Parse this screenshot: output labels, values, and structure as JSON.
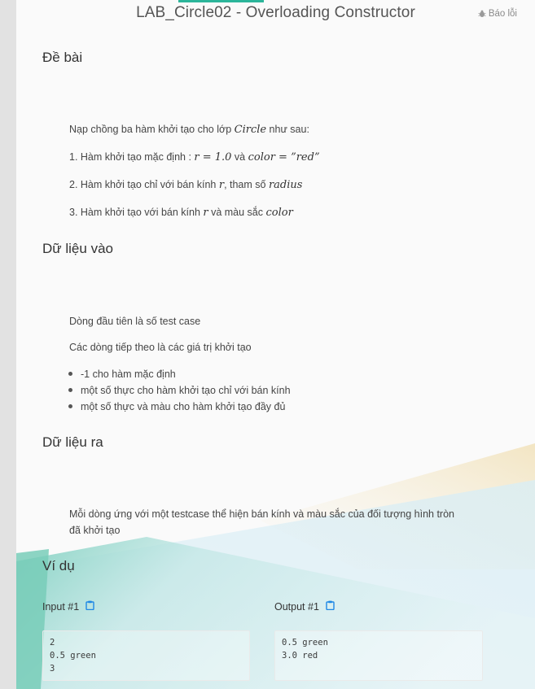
{
  "header": {
    "title": "LAB_Circle02 - Overloading Constructor",
    "report_label": "Báo lỗi",
    "report_icon": "bug-icon"
  },
  "sections": {
    "problem": {
      "heading": "Đề bài",
      "intro_pre": "Nạp chồng ba hàm khởi tạo cho lớp ",
      "intro_math": "Circle",
      "intro_post": " như sau:",
      "item1_pre": "1. Hàm khởi tạo mặc định : ",
      "item1_math1": "r = 1.0",
      "item1_mid": " và ",
      "item1_math2": "color = ”red”",
      "item2_pre": "2. Hàm khởi tạo chỉ với bán kính ",
      "item2_math1": "r",
      "item2_mid": ", tham số ",
      "item2_math2": "radius",
      "item3_pre": "3. Hàm khởi tạo với bán kính ",
      "item3_math1": "r",
      "item3_mid": " và màu sắc ",
      "item3_math2": "color"
    },
    "input": {
      "heading": "Dữ liệu vào",
      "line1": "Dòng đầu tiên là số test case",
      "line2": "Các dòng tiếp theo là các giá trị khởi tạo",
      "bullets": [
        "-1 cho hàm mặc định",
        "một số thực cho hàm khởi tạo chỉ với bán kính",
        "một số thực và màu cho hàm khởi tạo đầy đủ"
      ]
    },
    "output": {
      "heading": "Dữ liệu ra",
      "line1": "Mỗi dòng ứng với một testcase thể hiện bán kính và màu sắc của đối tượng hình tròn",
      "line2": "đã khởi tạo"
    },
    "example": {
      "heading": "Ví dụ",
      "input_label": "Input #1",
      "output_label": "Output #1",
      "copy_icon": "clipboard-icon",
      "input_lines": [
        "2",
        "0.5 green",
        "3"
      ],
      "output_lines": [
        "0.5 green",
        "3.0 red"
      ]
    }
  },
  "colors": {
    "accent": "#2bb59a",
    "copy_icon": "#1e88e5"
  }
}
